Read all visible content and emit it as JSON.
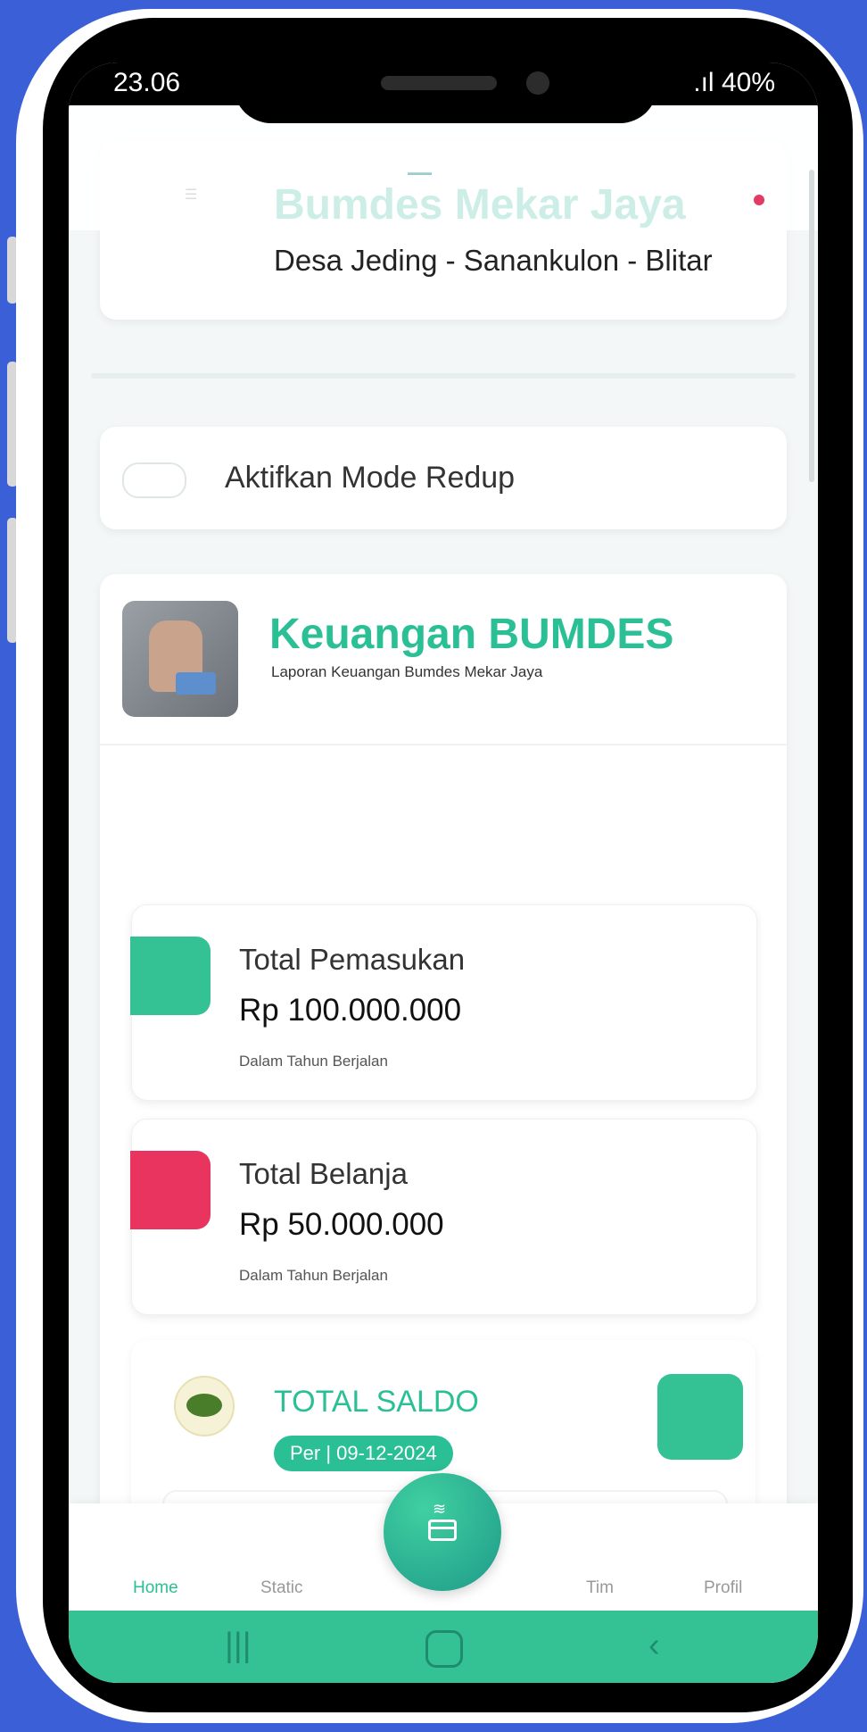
{
  "status_bar": {
    "time": "23.06",
    "signal": ".ıl",
    "battery": "40%"
  },
  "header": {
    "title": "Bumdes Mekar Jaya",
    "subtitle": "Desa Jeding - Sanankulon - Blitar"
  },
  "toggle": {
    "label": "Aktifkan Mode Redup",
    "enabled": false
  },
  "finance": {
    "title": "Keuangan BUMDES",
    "subtitle": "Laporan Keuangan Bumdes Mekar Jaya"
  },
  "stats": [
    {
      "label": "Total Pemasukan",
      "value": "Rp 100.000.000",
      "note": "Dalam Tahun Berjalan",
      "color": "#34c294"
    },
    {
      "label": "Total Belanja",
      "value": "Rp 50.000.000",
      "note": "Dalam Tahun Berjalan",
      "color": "#e8345e"
    }
  ],
  "saldo": {
    "title": "TOTAL SALDO",
    "date": "Per | 09-12-2024"
  },
  "bottom_nav": {
    "home": "Home",
    "static": "Static",
    "tim": "Tim",
    "profil": "Profil"
  },
  "colors": {
    "accent": "#2bbf95",
    "expense": "#e8345e",
    "background": "#3a5fd6"
  }
}
